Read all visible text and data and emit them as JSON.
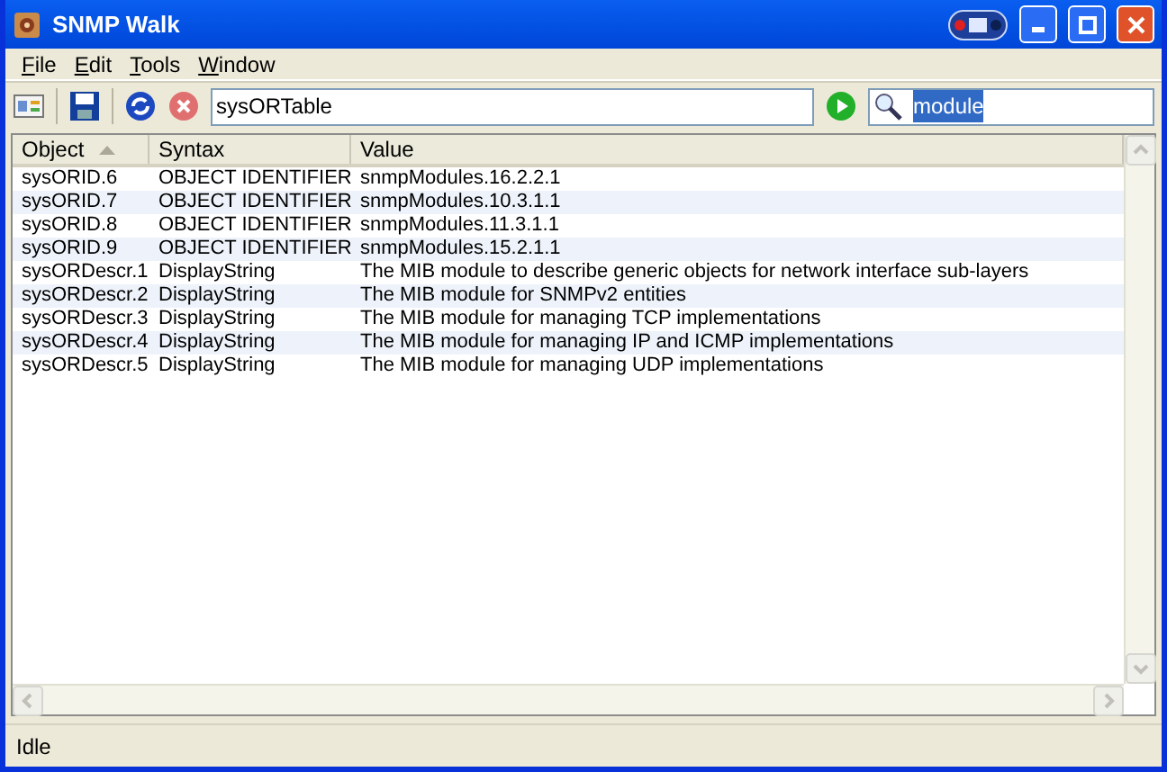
{
  "window": {
    "title": "SNMP Walk"
  },
  "menu": [
    {
      "label": "File",
      "mnemonic": true
    },
    {
      "label": "Edit",
      "mnemonic": true
    },
    {
      "label": "Tools",
      "mnemonic": true
    },
    {
      "label": "Window",
      "mnemonic": true
    }
  ],
  "toolbar": {
    "oid": "sysORTable",
    "search": {
      "value": "module",
      "text_selected": true
    }
  },
  "table": {
    "columns": [
      {
        "label": "Object",
        "sorted": true
      },
      {
        "label": "Syntax",
        "sorted": false
      },
      {
        "label": "Value",
        "sorted": false
      }
    ],
    "rows": [
      {
        "cells": [
          "sysORID.6",
          "OBJECT IDENTIFIER",
          "snmpModules.16.2.2.1"
        ]
      },
      {
        "cells": [
          "sysORID.7",
          "OBJECT IDENTIFIER",
          "snmpModules.10.3.1.1"
        ]
      },
      {
        "cells": [
          "sysORID.8",
          "OBJECT IDENTIFIER",
          "snmpModules.11.3.1.1"
        ]
      },
      {
        "cells": [
          "sysORID.9",
          "OBJECT IDENTIFIER",
          "snmpModules.15.2.1.1"
        ]
      },
      {
        "cells": [
          "sysORDescr.1",
          "DisplayString",
          "The MIB module to describe generic objects for network interface sub-layers"
        ]
      },
      {
        "cells": [
          "sysORDescr.2",
          "DisplayString",
          "The MIB module for SNMPv2 entities"
        ]
      },
      {
        "cells": [
          "sysORDescr.3",
          "DisplayString",
          "The MIB module for managing TCP implementations"
        ]
      },
      {
        "cells": [
          "sysORDescr.4",
          "DisplayString",
          "The MIB module for managing IP and ICMP implementations"
        ]
      },
      {
        "cells": [
          "sysORDescr.5",
          "DisplayString",
          "The MIB module for managing UDP implementations"
        ]
      }
    ]
  },
  "status_bar": "Idle"
}
